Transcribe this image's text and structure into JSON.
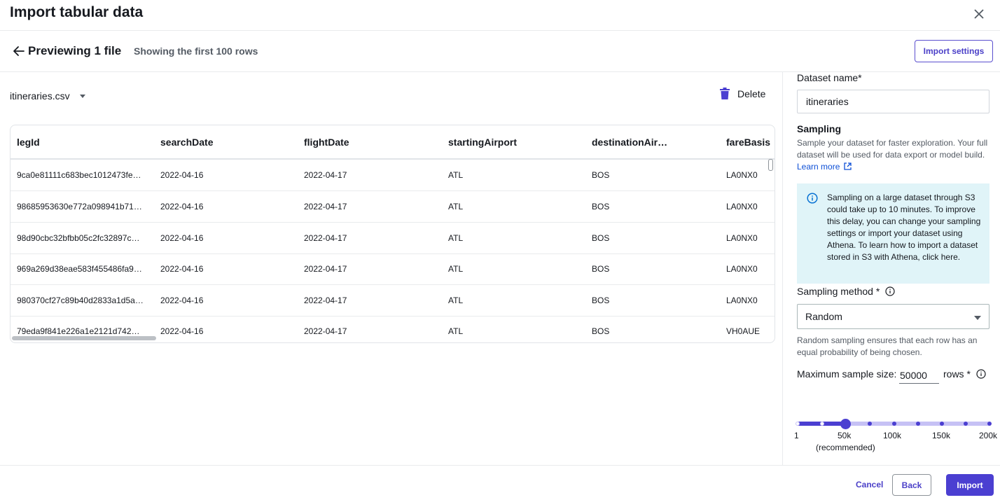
{
  "dialog": {
    "title": "Import tabular data",
    "close_icon": "close-icon"
  },
  "preview": {
    "heading": "Previewing 1 file",
    "subheading": "Showing the first 100 rows",
    "import_settings_label": "Import settings",
    "file_name": "itineraries.csv",
    "delete_label": "Delete"
  },
  "table": {
    "columns": [
      "legId",
      "searchDate",
      "flightDate",
      "startingAirport",
      "destinationAir…",
      "fareBasis"
    ],
    "rows": [
      [
        "9ca0e81111c683bec1012473fe…",
        "2022-04-16",
        "2022-04-17",
        "ATL",
        "BOS",
        "LA0NX0"
      ],
      [
        "98685953630e772a098941b71…",
        "2022-04-16",
        "2022-04-17",
        "ATL",
        "BOS",
        "LA0NX0"
      ],
      [
        "98d90cbc32bfbb05c2fc32897c…",
        "2022-04-16",
        "2022-04-17",
        "ATL",
        "BOS",
        "LA0NX0"
      ],
      [
        "969a269d38eae583f455486fa9…",
        "2022-04-16",
        "2022-04-17",
        "ATL",
        "BOS",
        "LA0NX0"
      ],
      [
        "980370cf27c89b40d2833a1d5a…",
        "2022-04-16",
        "2022-04-17",
        "ATL",
        "BOS",
        "LA0NX0"
      ],
      [
        "79eda9f841e226a1e2121d742…",
        "2022-04-16",
        "2022-04-17",
        "ATL",
        "BOS",
        "VH0AUE"
      ]
    ]
  },
  "settings": {
    "dataset_name_label": "Dataset name*",
    "dataset_name_value": "itineraries",
    "sampling_title": "Sampling",
    "sampling_desc": "Sample your dataset for faster exploration. Your full dataset will be used for data export or model build.",
    "learn_more": "Learn more",
    "info_text": "Sampling on a large dataset through S3 could take up to 10 minutes. To improve this delay, you can change your sampling settings or import your dataset using Athena. To learn how to import a dataset stored in S3 with Athena, click here.",
    "sampling_method_label": "Sampling method *",
    "sampling_method_value": "Random",
    "sampling_method_help": "Random sampling ensures that each row has an equal probability of being chosen.",
    "max_sample_label": "Maximum sample size:",
    "max_sample_value": "50000",
    "rows_label": "rows *",
    "slider": {
      "min_label": "1",
      "labels": [
        "1",
        "50k",
        "100k",
        "150k",
        "200k"
      ],
      "recommended": "(recommended)",
      "value": 50000,
      "max": 200000
    }
  },
  "footer": {
    "cancel": "Cancel",
    "back": "Back",
    "import": "Import"
  },
  "colors": {
    "accent": "#4b3fd1",
    "info_bg": "#e0f4f8",
    "link": "#0d4fd6"
  }
}
